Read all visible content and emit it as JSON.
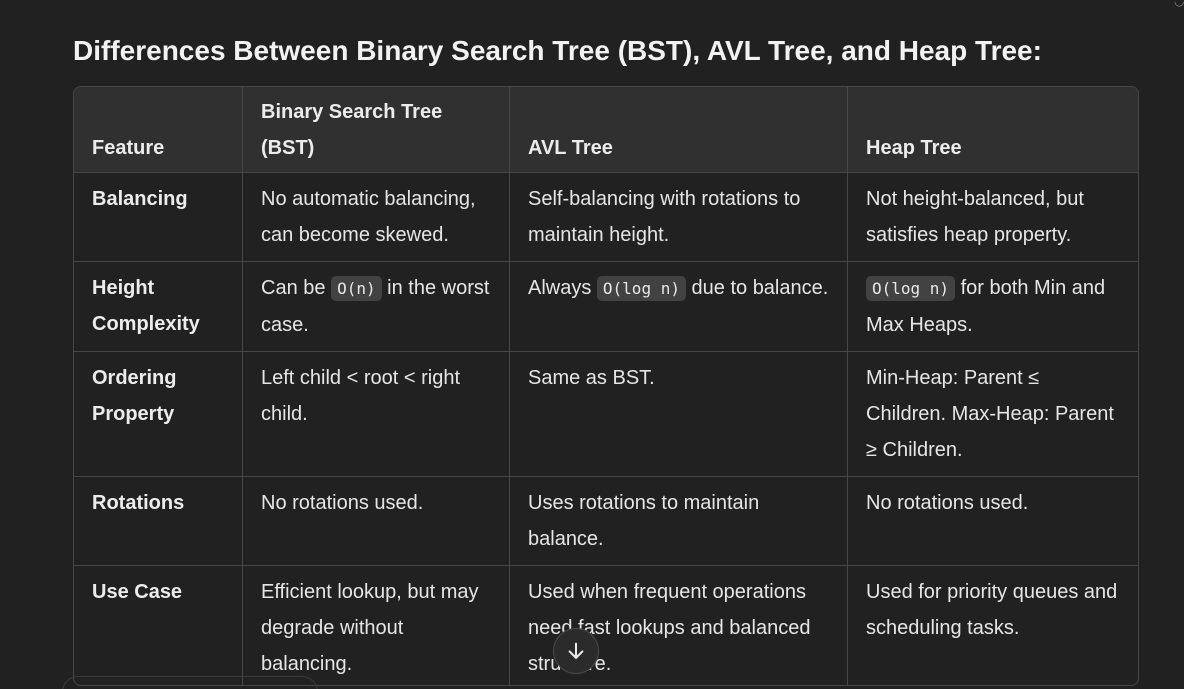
{
  "heading": "Differences Between Binary Search Tree (BST), AVL Tree, and Heap Tree:",
  "table": {
    "headers": {
      "feature": "Feature",
      "bst_line1": "Binary Search Tree",
      "bst_line2": "(BST)",
      "avl": "AVL Tree",
      "heap": "Heap Tree"
    },
    "rows": {
      "balancing": {
        "feature": "Balancing",
        "bst": "No automatic balancing, can become skewed.",
        "avl": "Self-balancing with rotations to maintain height.",
        "heap": "Not height-balanced, but satisfies heap property."
      },
      "height": {
        "feature": "Height Complexity",
        "bst_pre": "Can be ",
        "bst_code": "O(n)",
        "bst_post": " in the worst case.",
        "avl_pre": "Always ",
        "avl_code": "O(log n)",
        "avl_post": " due to balance.",
        "heap_code": "O(log n)",
        "heap_post": " for both Min and Max Heaps."
      },
      "ordering": {
        "feature": "Ordering Property",
        "bst": "Left child < root < right child.",
        "avl": "Same as BST.",
        "heap": "Min-Heap: Parent ≤ Children. Max-Heap: Parent ≥ Children."
      },
      "rotations": {
        "feature": "Rotations",
        "bst": "No rotations used.",
        "avl": "Uses rotations to maintain balance.",
        "heap": "No rotations used."
      },
      "usecase": {
        "feature": "Use Case",
        "bst": "Efficient lookup, but may degrade without balancing.",
        "avl": "Used when frequent operations need fast lookups and balanced structure.",
        "heap": "Used for priority queues and scheduling tasks."
      }
    }
  },
  "scroll_down_icon": "arrow-down-icon",
  "colors": {
    "background": "#212121",
    "header_bg": "#303030",
    "border": "#474747",
    "code_bg": "#424242"
  }
}
